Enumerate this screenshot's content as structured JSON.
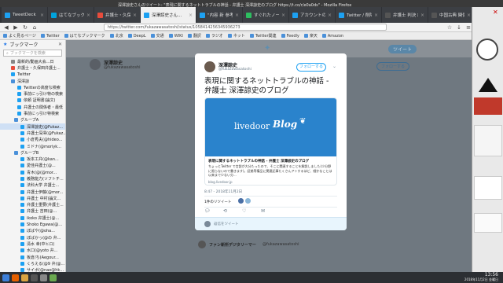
{
  "window_title": "深澤諒史さんのツイート: \"表現に関するネットトラブルの神話 - 弁護士 深澤諒史のブログ https://t.co/r/e0a0ds\" - Mozilla Firefox",
  "tabs": [
    {
      "label": "TweetDeck",
      "color": "#1da1f2",
      "active": false
    },
    {
      "label": "はてなブックマーク - hat...",
      "color": "#00a4de",
      "active": false
    },
    {
      "label": "弁護士・久保田弁護士の...",
      "color": "#e74c3c",
      "active": false
    },
    {
      "label": "深澤諒史さん...",
      "color": "#1da1f2",
      "active": true
    },
    {
      "label": "\"内容 新 参考 弁護士...",
      "color": "#1da1f2",
      "active": false
    },
    {
      "label": "すぐれたノート - Evernote",
      "color": "#2dbe60",
      "active": false
    },
    {
      "label": "アカウントの管理",
      "color": "#1da1f2",
      "active": false
    },
    {
      "label": "Twitter / 削除",
      "color": "#1da1f2",
      "active": false
    },
    {
      "label": "弁護士 判決 創作...",
      "color": "#555555",
      "active": false
    },
    {
      "label": "中国古典 関係の解説...",
      "color": "#555555",
      "active": false
    }
  ],
  "nav": {
    "url": "https://twitter.com/fukazawasatoshi/status/1058414256345936273"
  },
  "bookmarks_bar": [
    "よく見るページ",
    "Twitter",
    "はてなブックマーク",
    "北京",
    "DeepL",
    "交通",
    "WIKI",
    "翻訳",
    "ラジオ",
    "ネット",
    "Twitter関連",
    "Feedly",
    "楽天",
    "Amazon"
  ],
  "sidebar": {
    "title": "ブックマーク",
    "search_placeholder": "ブックマークを検索",
    "items": [
      {
        "label": "最新的/動画大会...日",
        "color": "#888",
        "indent": 14,
        "sel": false
      },
      {
        "label": "弁護士・久保田弁護士...",
        "color": "#e74c3c",
        "indent": 14,
        "sel": false
      },
      {
        "label": "Twitter",
        "color": "#1da1f2",
        "indent": 14,
        "sel": false
      },
      {
        "label": "深澤諒",
        "color": "#4a90d9",
        "indent": 14,
        "sel": false
      },
      {
        "label": "Twitterの高度な検索",
        "color": "#1da1f2",
        "indent": 22,
        "sel": false
      },
      {
        "label": "事前にっ引け特の検索",
        "color": "#1da1f2",
        "indent": 22,
        "sel": false
      },
      {
        "label": "依頼 証明書(論文)",
        "color": "#1da1f2",
        "indent": 22,
        "sel": false
      },
      {
        "label": "弁護士の関係者・最低",
        "color": "#1da1f2",
        "indent": 22,
        "sel": false
      },
      {
        "label": "事前にっ引け特検索",
        "color": "#1da1f2",
        "indent": 22,
        "sel": false
      },
      {
        "label": "グループA",
        "color": "#4a90d9",
        "indent": 18,
        "sel": false
      },
      {
        "label": "深澤諒史(@Fukaz...",
        "color": "#1da1f2",
        "indent": 26,
        "sel": true
      },
      {
        "label": "弁護士深澤(@Fukaz...",
        "color": "#1da1f2",
        "indent": 26,
        "sel": false
      },
      {
        "label": "小倉秀夫(@hideo...",
        "color": "#1da1f2",
        "indent": 26,
        "sel": false
      },
      {
        "label": "ミドナ(@moriyk...",
        "color": "#1da1f2",
        "indent": 26,
        "sel": false
      },
      {
        "label": "グループB",
        "color": "#4a90d9",
        "indent": 18,
        "sel": false
      },
      {
        "label": "坂本工弁(@kan...",
        "color": "#1da1f2",
        "indent": 26,
        "sel": false
      },
      {
        "label": "愛佳弁護士(@...",
        "color": "#1da1f2",
        "indent": 26,
        "sel": false
      },
      {
        "label": "青木(@(@mor...",
        "color": "#1da1f2",
        "indent": 26,
        "sel": false
      },
      {
        "label": "義務能力(ソフトチ...",
        "color": "#1da1f2",
        "indent": 26,
        "sel": false
      },
      {
        "label": "法科大学 弁護士...",
        "color": "#1da1f2",
        "indent": 26,
        "sel": false
      },
      {
        "label": "弁護士伊藤(@mor...",
        "color": "#1da1f2",
        "indent": 26,
        "sel": false
      },
      {
        "label": "弁護士 中村(論文...",
        "color": "#1da1f2",
        "indent": 26,
        "sel": false
      },
      {
        "label": "弁護士重要(弁護士...",
        "color": "#1da1f2",
        "indent": 26,
        "sel": false
      },
      {
        "label": "弁護士 吉田(@...",
        "color": "#1da1f2",
        "indent": 26,
        "sel": false
      },
      {
        "label": "ikoko 弁護士(@...",
        "color": "#1da1f2",
        "indent": 26,
        "sel": false
      },
      {
        "label": "Shoko Egawa(@...",
        "color": "#1da1f2",
        "indent": 26,
        "sel": false
      },
      {
        "label": "ぼばや(@oha...",
        "color": "#1da1f2",
        "indent": 26,
        "sel": false
      },
      {
        "label": "ぼばかっ(@の 弁...",
        "color": "#1da1f2",
        "indent": 26,
        "sel": false
      },
      {
        "label": "清水 幸(中ヒロ)",
        "color": "#1da1f2",
        "indent": 26,
        "sel": false
      },
      {
        "label": "水口(@yoto 弁...",
        "color": "#1da1f2",
        "indent": 26,
        "sel": false
      },
      {
        "label": "板倉/ち(Aegour...",
        "color": "#1da1f2",
        "indent": 26,
        "sel": false
      },
      {
        "label": "くろえる(@9 弁(@...",
        "color": "#1da1f2",
        "indent": 26,
        "sel": false
      },
      {
        "label": "サイボ(@nao@hk...",
        "color": "#1da1f2",
        "indent": 26,
        "sel": false
      },
      {
        "label": "ytsk@fukkuo(3...",
        "color": "#1da1f2",
        "indent": 26,
        "sel": false
      },
      {
        "label": "ねわさ(@...",
        "color": "#1da1f2",
        "indent": 26,
        "sel": false
      }
    ]
  },
  "tweet_modal": {
    "author_name": "深澤諒史",
    "author_handle": "@fukazawasatoshi",
    "follow_label": "フォローする",
    "text": "表現に関するネットトラブルの神話 - 弁護士 深澤諒史のブログ",
    "card_brand": "livedoor",
    "card_brand2": "Blog",
    "card_title": "表現に関するネットトラブルの神話 - 弁護士 深澤諒史のブログ",
    "card_desc": "ちょっとTwitter で言説が大分たったので、そこに関連することを解説しました(少分野に限らないので書きます)。証拠等備品に関連記事たくさんアトするほど、細かなことは以来まで少ない分...",
    "card_domain": "blog.livedoor.jp",
    "timestamp": "8:47 - 2018年11月2日",
    "retweet_label": "1件のリツイート",
    "reply_placeholder": "返信をツイート"
  },
  "behind": {
    "profile_name": "深澤諒史",
    "profile_handle": "@fukazawasatoshi",
    "follow_btn": "フォローする",
    "tweet_btn": "ツイート",
    "below_name": "ファン新所デジタリーマー",
    "below_handle": "@fukazawasatoshi"
  },
  "taskbar": {
    "time": "13:56",
    "date": "2018年11月2日 金曜日"
  },
  "colors": {
    "twitter_blue": "#1da1f2",
    "livedoor_blue": "#2a83cc"
  }
}
